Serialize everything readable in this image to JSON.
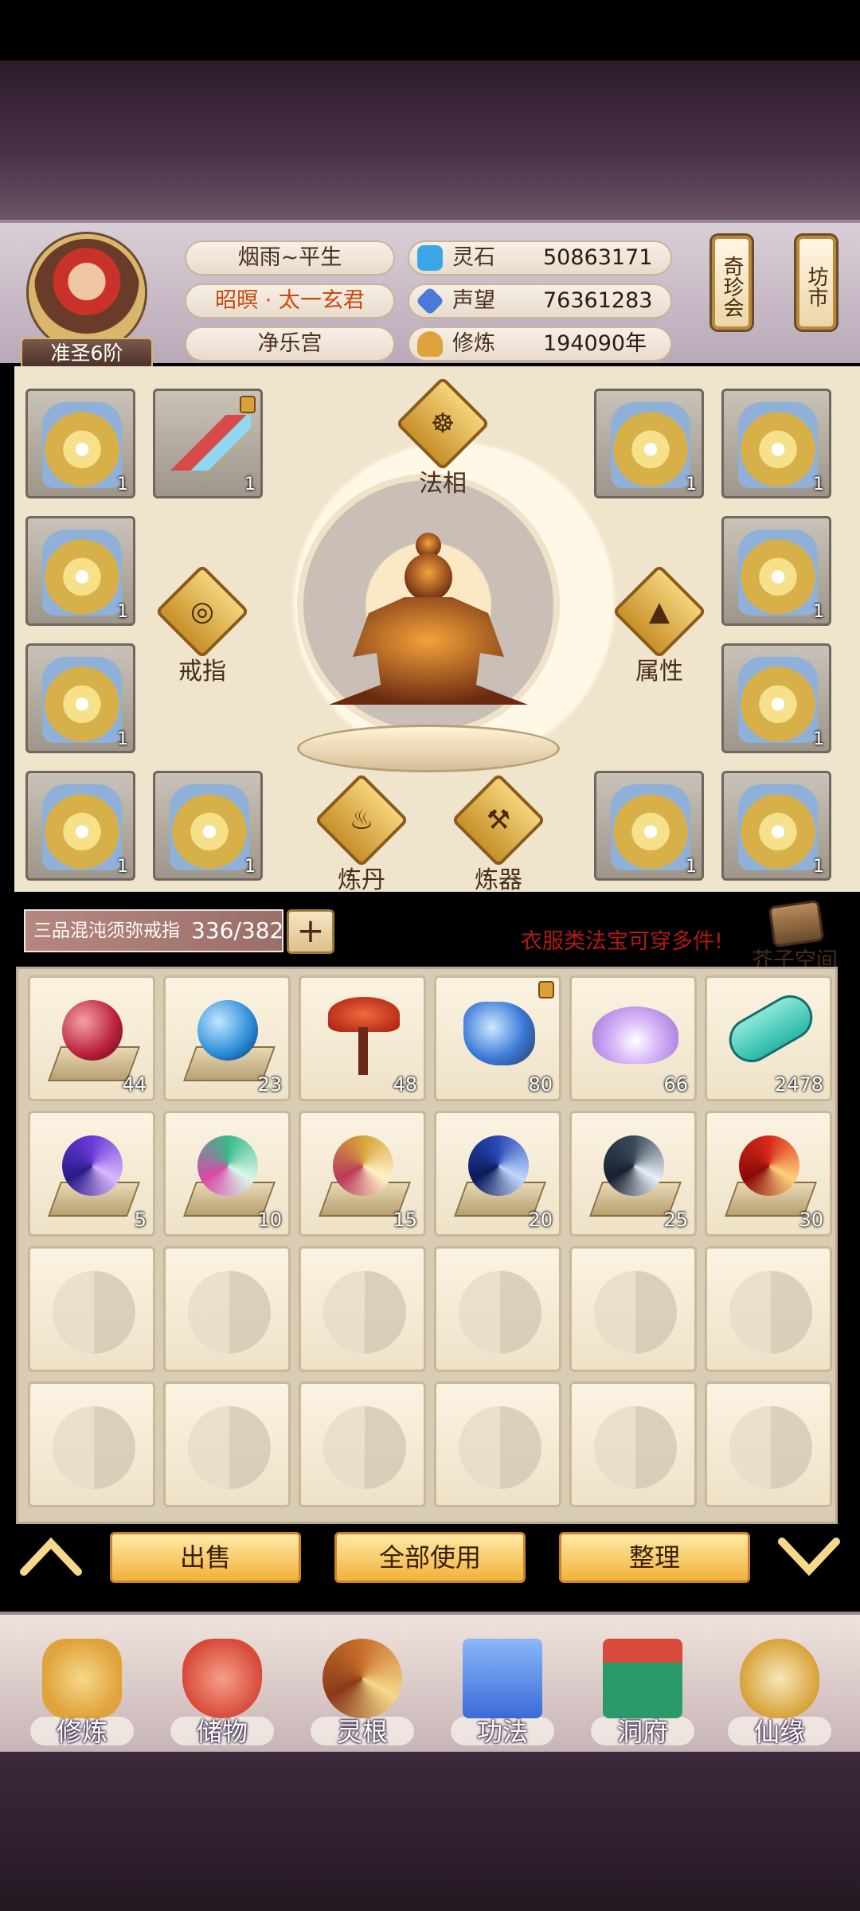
{
  "player": {
    "rank": "准圣6阶",
    "name": "烟雨~平生",
    "title": "昭暝 · 太一玄君",
    "sect": "净乐宫"
  },
  "stats": [
    {
      "label": "灵石",
      "value": "50863171",
      "icon": "spirit-stone-icon",
      "color": "#3aa6e8"
    },
    {
      "label": "声望",
      "value": "76361283",
      "icon": "reputation-crystal-icon",
      "color": "#4a7ad8"
    },
    {
      "label": "修炼",
      "value": "194090年",
      "icon": "meditation-icon",
      "color": "#e0a23a"
    }
  ],
  "side_buttons": {
    "treasure_fair": "奇珍会",
    "market": "坊市"
  },
  "equipment": {
    "slots": [
      {
        "item": "golden-armor",
        "qty": "1"
      },
      {
        "item": "flame-sword",
        "qty": "1",
        "locked": true
      },
      {
        "item": "golden-armor",
        "qty": "1"
      },
      {
        "item": "golden-armor",
        "qty": "1"
      },
      {
        "item": "golden-armor",
        "qty": "1"
      },
      {
        "item": "golden-armor",
        "qty": "1"
      },
      {
        "item": "golden-armor",
        "qty": "1"
      },
      {
        "item": "golden-armor",
        "qty": "1"
      },
      {
        "item": "golden-armor",
        "qty": "1"
      },
      {
        "item": "golden-armor",
        "qty": "1"
      },
      {
        "item": "golden-armor",
        "qty": "1"
      },
      {
        "item": "golden-armor",
        "qty": "1"
      }
    ],
    "features": {
      "faxiang": "法相",
      "ring": "戒指",
      "attributes": "属性",
      "alchemy": "炼丹",
      "forging": "炼器"
    }
  },
  "storage": {
    "ring_name": "三品混沌须弥戒指",
    "capacity": "336/382",
    "notice": "衣服类法宝可穿多件!",
    "space_label": "芥子空间"
  },
  "inventory": [
    {
      "item": "red-orb-on-stand",
      "qty": "44",
      "color": "#b8203a"
    },
    {
      "item": "blue-orb-on-stand",
      "qty": "23",
      "color": "#2a8ad8"
    },
    {
      "item": "red-spirit-mushroom",
      "qty": "48",
      "color": "#c83a2a"
    },
    {
      "item": "blue-ore-crystal",
      "qty": "80",
      "color": "#3a7ad8",
      "locked": true
    },
    {
      "item": "purple-lotus",
      "qty": "66",
      "color": "#b88ae8"
    },
    {
      "item": "teal-scroll",
      "qty": "2478",
      "color": "#2ab8a8"
    },
    {
      "item": "violet-swirl-orb",
      "qty": "5",
      "color": "#6a3ad8"
    },
    {
      "item": "green-swirl-orb",
      "qty": "10",
      "color": "#3ab88a"
    },
    {
      "item": "gold-swirl-orb",
      "qty": "15",
      "color": "#d8a23a"
    },
    {
      "item": "deep-blue-swirl-orb",
      "qty": "20",
      "color": "#2a4ab8"
    },
    {
      "item": "dark-swirl-orb",
      "qty": "25",
      "color": "#3a4a5a"
    },
    {
      "item": "red-swirl-orb",
      "qty": "30",
      "color": "#d82a1a"
    }
  ],
  "actions": {
    "sell": "出售",
    "use_all": "全部使用",
    "organize": "整理"
  },
  "nav": [
    {
      "label": "修炼",
      "icon": "cultivate-icon",
      "color": "#e0a23a"
    },
    {
      "label": "储物",
      "icon": "storage-bag-icon",
      "color": "#d84a3a"
    },
    {
      "label": "灵根",
      "icon": "spirit-root-icon",
      "color": "#c8702a"
    },
    {
      "label": "功法",
      "icon": "technique-book-icon",
      "color": "#3a6ad8"
    },
    {
      "label": "洞府",
      "icon": "cave-abode-icon",
      "color": "#2a9a6a"
    },
    {
      "label": "仙缘",
      "icon": "immortal-gourd-icon",
      "color": "#d8a23a"
    }
  ]
}
